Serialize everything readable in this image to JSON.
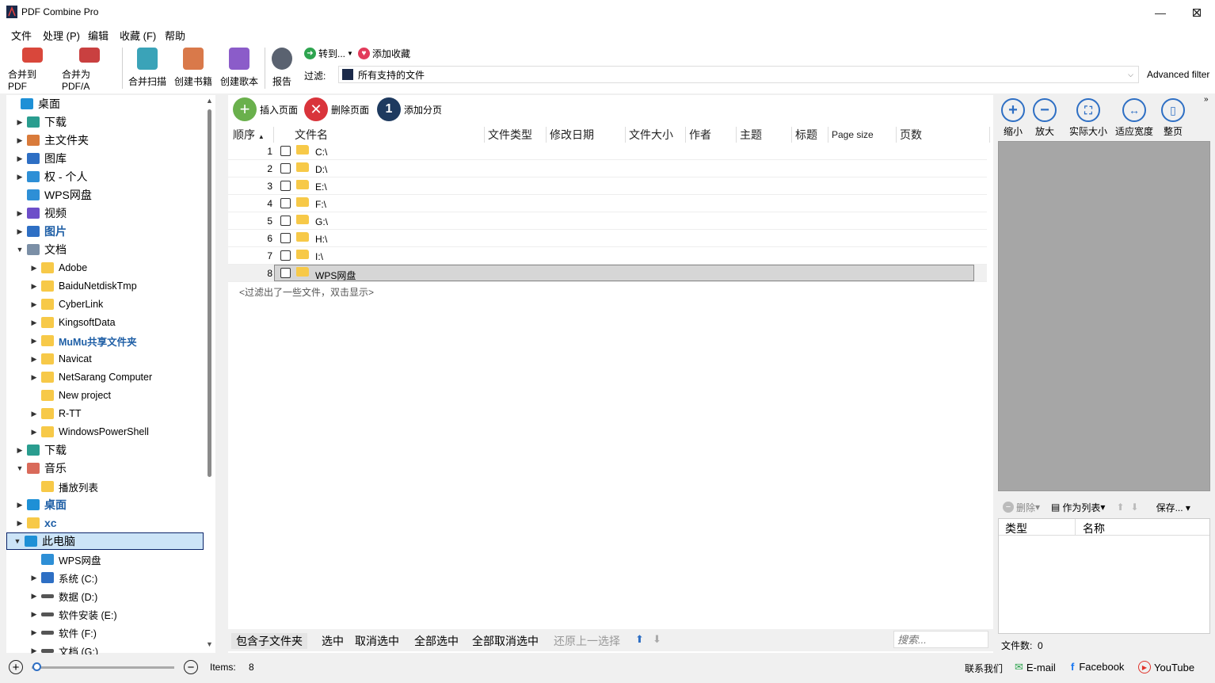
{
  "app": {
    "title": "PDF Combine Pro"
  },
  "window": {
    "min": "—",
    "max": "☐",
    "close": "✕"
  },
  "menu": [
    "文件",
    "处理 (P)",
    "编辑",
    "收藏 (F)",
    "帮助"
  ],
  "toolbar": {
    "buttons": [
      "合并到 PDF",
      "合并为PDF/A",
      "合并扫描",
      "创建书籍",
      "创建歌本",
      "报告"
    ],
    "goto": "转到...",
    "favorite": "添加收藏",
    "filter_label": "过滤:",
    "filter_value": "所有支持的文件",
    "advanced": "Advanced filter"
  },
  "tree": [
    {
      "label": "桌面",
      "arrow": "",
      "indent": 0,
      "icon": "desktop"
    },
    {
      "label": "下载",
      "arrow": "▶",
      "indent": 1,
      "icon": "download"
    },
    {
      "label": "主文件夹",
      "arrow": "▶",
      "indent": 1,
      "icon": "home"
    },
    {
      "label": "图库",
      "arrow": "▶",
      "indent": 1,
      "icon": "gallery"
    },
    {
      "label": "权 - 个人",
      "arrow": "▶",
      "indent": 1,
      "icon": "cloud"
    },
    {
      "label": "WPS网盘",
      "arrow": "",
      "indent": 1,
      "icon": "cloud"
    },
    {
      "label": "视频",
      "arrow": "▶",
      "indent": 1,
      "icon": "video"
    },
    {
      "label": "图片",
      "arrow": "▶",
      "indent": 1,
      "icon": "picture",
      "bold": true
    },
    {
      "label": "文档",
      "arrow": "▼",
      "indent": 1,
      "icon": "doc"
    },
    {
      "label": "Adobe",
      "arrow": "▶",
      "indent": 2,
      "icon": "folder"
    },
    {
      "label": "BaiduNetdiskTmp",
      "arrow": "▶",
      "indent": 2,
      "icon": "folder"
    },
    {
      "label": "CyberLink",
      "arrow": "▶",
      "indent": 2,
      "icon": "folder"
    },
    {
      "label": "KingsoftData",
      "arrow": "▶",
      "indent": 2,
      "icon": "folder"
    },
    {
      "label": "MuMu共享文件夹",
      "arrow": "▶",
      "indent": 2,
      "icon": "folder",
      "bold": true
    },
    {
      "label": "Navicat",
      "arrow": "▶",
      "indent": 2,
      "icon": "folder"
    },
    {
      "label": "NetSarang Computer",
      "arrow": "▶",
      "indent": 2,
      "icon": "folder"
    },
    {
      "label": "New project",
      "arrow": "",
      "indent": 2,
      "icon": "folder"
    },
    {
      "label": "R-TT",
      "arrow": "▶",
      "indent": 2,
      "icon": "folder"
    },
    {
      "label": "WindowsPowerShell",
      "arrow": "▶",
      "indent": 2,
      "icon": "folder"
    },
    {
      "label": "下载",
      "arrow": "▶",
      "indent": 1,
      "icon": "download"
    },
    {
      "label": "音乐",
      "arrow": "▼",
      "indent": 1,
      "icon": "music"
    },
    {
      "label": "播放列表",
      "arrow": "",
      "indent": 2,
      "icon": "folder"
    },
    {
      "label": "桌面",
      "arrow": "▶",
      "indent": 1,
      "icon": "desktop",
      "bold": true
    },
    {
      "label": "xc",
      "arrow": "▶",
      "indent": 1,
      "icon": "folder",
      "bold": true
    },
    {
      "label": "此电脑",
      "arrow": "▼",
      "indent": 1,
      "icon": "pc",
      "selected": true
    },
    {
      "label": "WPS网盘",
      "arrow": "",
      "indent": 2,
      "icon": "cloud"
    },
    {
      "label": "系统 (C:)",
      "arrow": "▶",
      "indent": 2,
      "icon": "drive-win"
    },
    {
      "label": "数据 (D:)",
      "arrow": "▶",
      "indent": 2,
      "icon": "drive"
    },
    {
      "label": "软件安装 (E:)",
      "arrow": "▶",
      "indent": 2,
      "icon": "drive"
    },
    {
      "label": "软件 (F:)",
      "arrow": "▶",
      "indent": 2,
      "icon": "drive"
    },
    {
      "label": "文档 (G:)",
      "arrow": "▶",
      "indent": 2,
      "icon": "drive"
    }
  ],
  "actions": {
    "insert": "插入页面",
    "delete": "删除页面",
    "add_split": "添加分页"
  },
  "columns": [
    "顺序",
    "文件名",
    "文件类型",
    "修改日期",
    "文件大小",
    "作者",
    "主题",
    "标题",
    "Page size",
    "页数"
  ],
  "files": [
    {
      "num": "1",
      "name": "C:\\"
    },
    {
      "num": "2",
      "name": "D:\\"
    },
    {
      "num": "3",
      "name": "E:\\"
    },
    {
      "num": "4",
      "name": "F:\\"
    },
    {
      "num": "5",
      "name": "G:\\"
    },
    {
      "num": "6",
      "name": "H:\\"
    },
    {
      "num": "7",
      "name": "I:\\"
    },
    {
      "num": "8",
      "name": "WPS网盘"
    }
  ],
  "filtered_note": "<过滤出了一些文件，双击显示>",
  "bottom": {
    "include_sub": "包含子文件夹",
    "select": "选中",
    "deselect": "取消选中",
    "select_all": "全部选中",
    "deselect_all": "全部取消选中",
    "restore": "还原上一选择",
    "search_placeholder": "搜索..."
  },
  "preview": {
    "buttons": [
      "缩小",
      "放大",
      "实际大小",
      "适应宽度",
      "整页"
    ],
    "delete": "删除",
    "as_list": "作为列表",
    "save": "保存...",
    "col_type": "类型",
    "col_name": "名称",
    "file_count_label": "文件数:",
    "file_count": "0"
  },
  "status": {
    "items_label": "Items:",
    "items": "8",
    "contact": "联系我们",
    "email": "E-mail",
    "facebook": "Facebook",
    "youtube": "YouTube"
  },
  "colors": {
    "accent": "#2e6fc4",
    "selection": "#cce4f7",
    "selected_border": "#0a246a"
  }
}
